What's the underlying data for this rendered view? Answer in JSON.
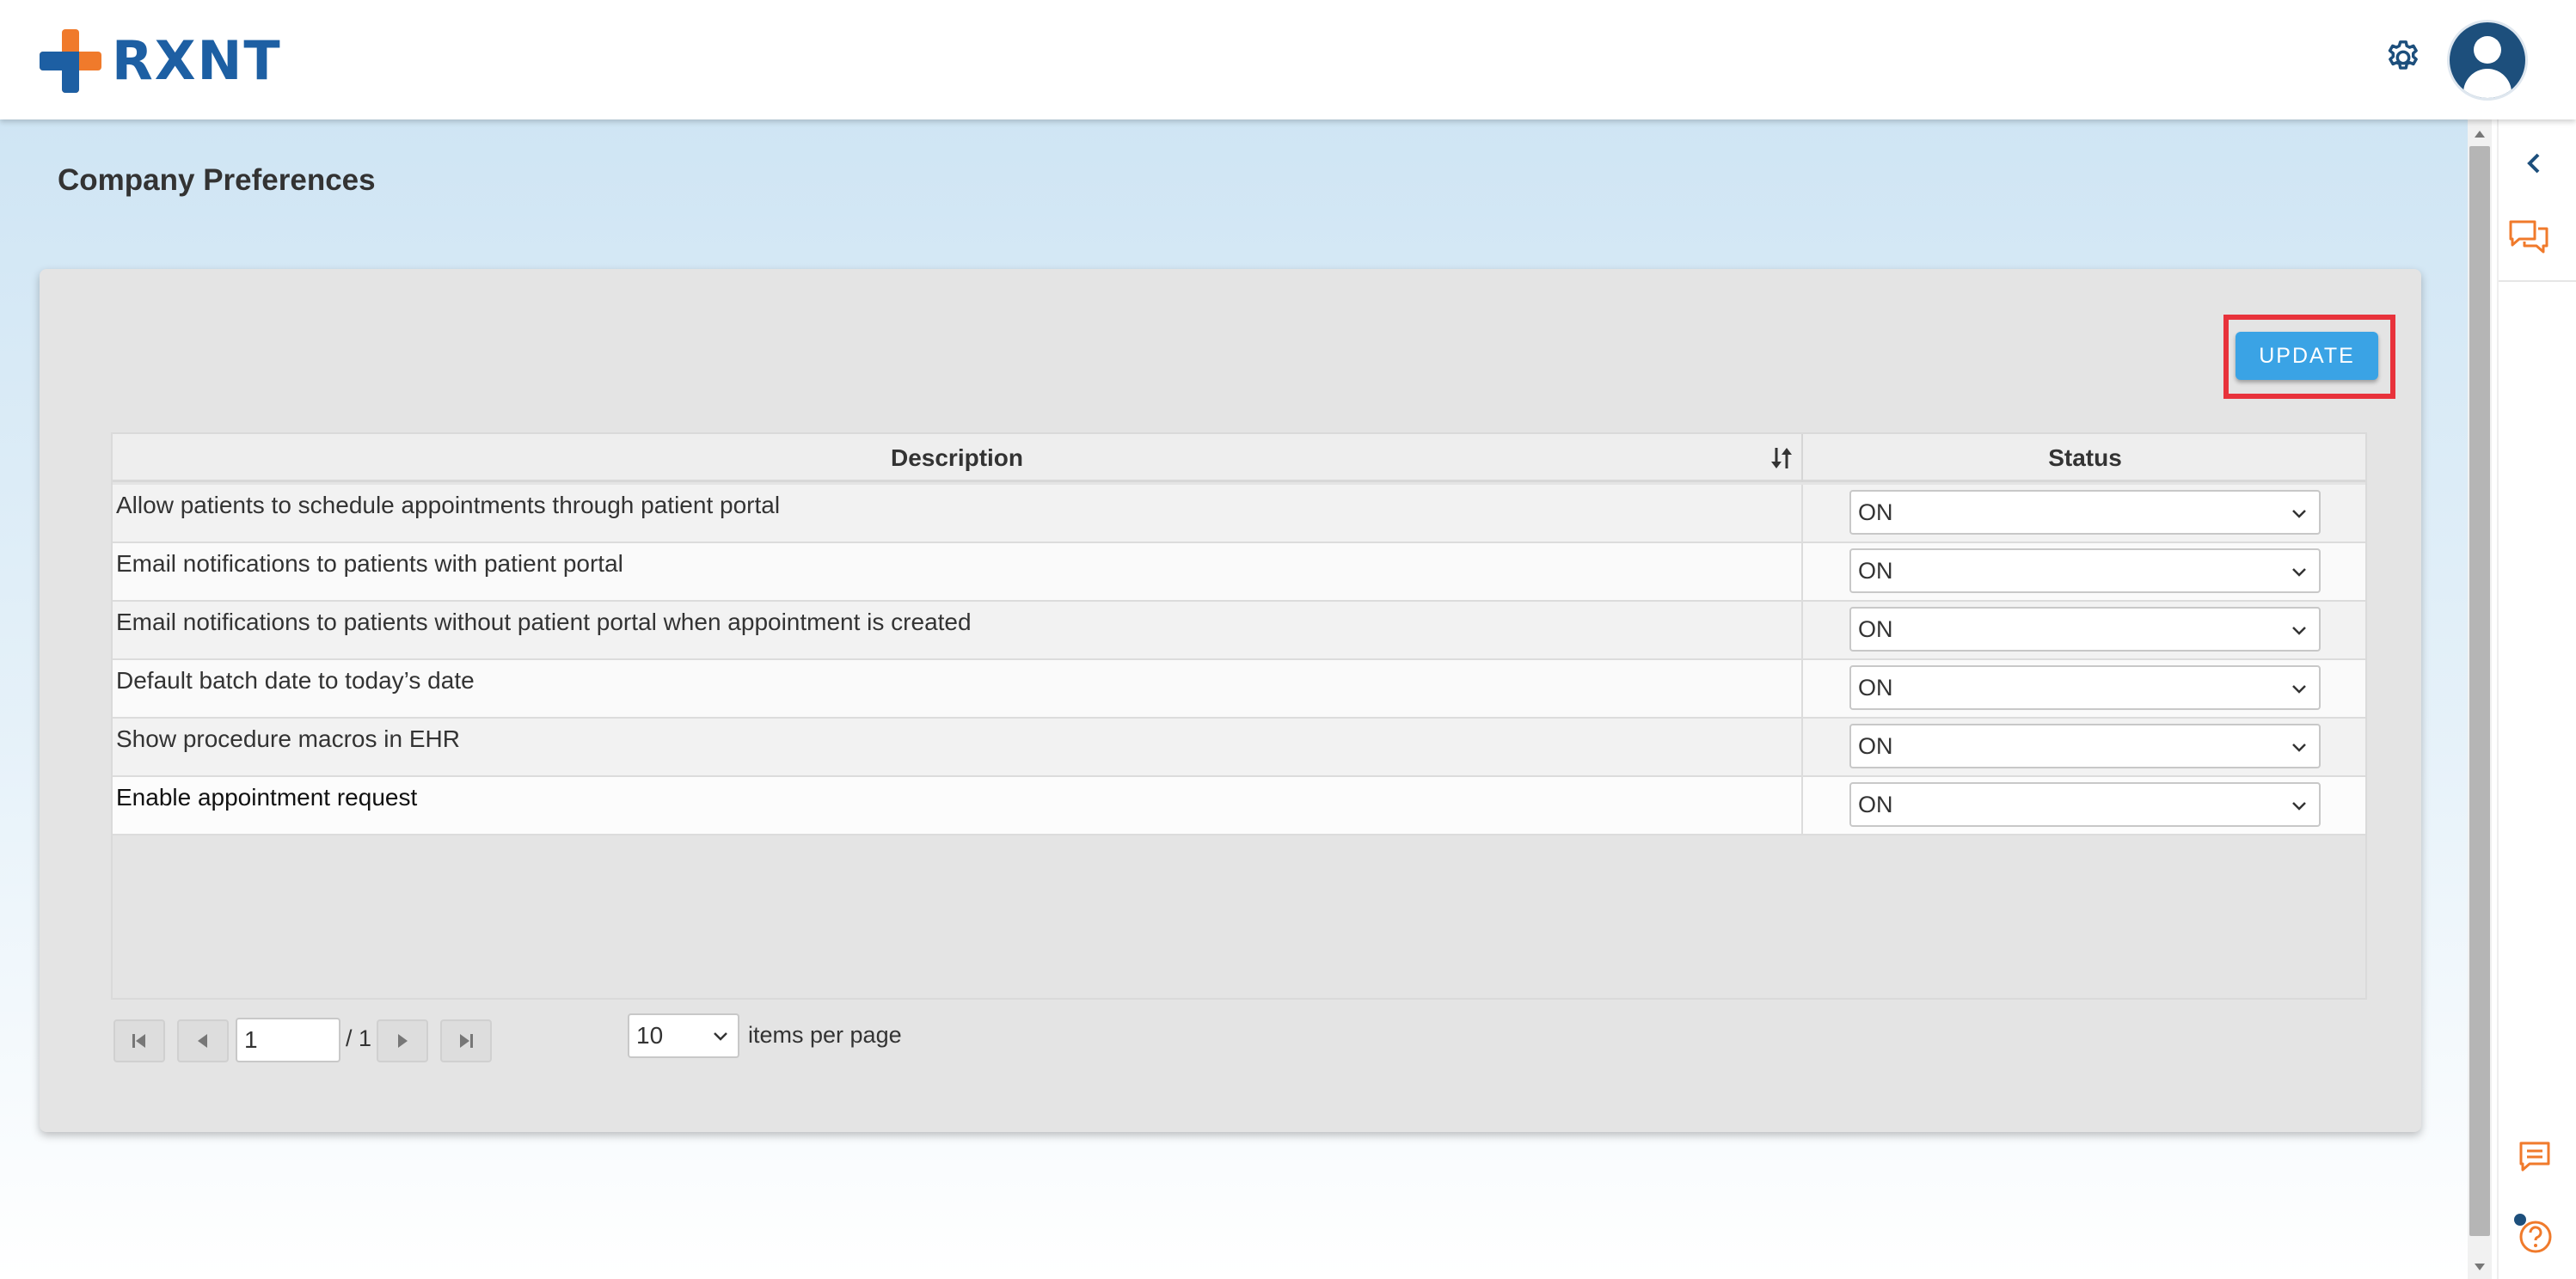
{
  "header": {
    "logo_text": "RXNT",
    "colors": {
      "brand_blue": "#1d5fa3",
      "brand_orange": "#f07a2b"
    },
    "icons": [
      "gear-icon",
      "user-avatar-icon"
    ]
  },
  "page": {
    "title": "Company Preferences",
    "update_label": "UPDATE",
    "accent": "#3aa3e5",
    "highlight_color": "#e8323b"
  },
  "table": {
    "columns": [
      "Description",
      "Status"
    ],
    "rows": [
      {
        "description": "Allow patients to schedule appointments through patient portal",
        "status": "ON"
      },
      {
        "description": "Email notifications to patients with patient portal",
        "status": "ON"
      },
      {
        "description": "Email notifications to patients without patient portal when appointment is created",
        "status": "ON"
      },
      {
        "description": "Default batch date to today’s date",
        "status": "ON"
      },
      {
        "description": "Show procedure macros in EHR",
        "status": "ON"
      },
      {
        "description": "Enable appointment request",
        "status": "ON"
      }
    ]
  },
  "pager": {
    "current_page": "1",
    "total_pages": "/ 1",
    "page_size": "10",
    "items_per_page_label": "items per page"
  },
  "rail": {
    "icons": [
      "chevron-left-icon",
      "chat-bubbles-icon",
      "message-icon",
      "help-icon"
    ]
  }
}
